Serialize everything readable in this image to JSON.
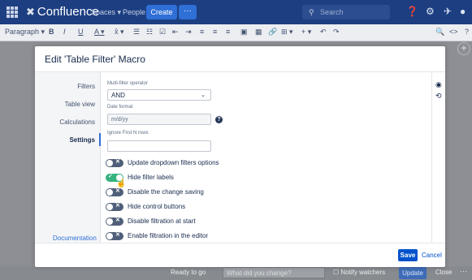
{
  "topnav": {
    "brand": "Confluence",
    "spaces": "Spaces ▾",
    "people": "People",
    "create": "Create",
    "more": "···",
    "search_placeholder": "Search",
    "bg_color": "#1d3f82"
  },
  "toolbar": {
    "paragraph": "Paragraph ▾",
    "bold": "B",
    "italic": "I",
    "underline": "U",
    "text_color": "A ▾",
    "more_format": "x̂ ▾",
    "bullets": "☰",
    "numbered": "☷",
    "task": "☑",
    "outdent": "⇤",
    "indent": "⇥",
    "align_left": "≡",
    "align_center": "≡",
    "align_right": "≡",
    "layout": "▣",
    "image": "▦",
    "link": "🔗",
    "table": "⊞ ▾",
    "insert": "+ ▾",
    "undo": "↶",
    "redo": "↷",
    "find": "🔍",
    "source": "<>",
    "help": "?"
  },
  "dialog": {
    "title": "Edit 'Table Filter' Macro",
    "nav": [
      "Filters",
      "Table view",
      "Calculations",
      "Settings"
    ],
    "active_nav": "Settings",
    "documentation": "Documentation",
    "fields": {
      "multi_filter_label": "Multi-filter operator",
      "multi_filter_value": "AND",
      "date_format_label": "Date format",
      "date_format_value": "m/d/yy",
      "ignore_rows_label": "Ignore First N rows",
      "ignore_rows_value": ""
    },
    "toggles": [
      {
        "label": "Update dropdown filters options",
        "on": false
      },
      {
        "label": "Hide filter labels",
        "on": true
      },
      {
        "label": "Disable the change saving",
        "on": false
      },
      {
        "label": "Hide control buttons",
        "on": false
      },
      {
        "label": "Disable filtration at start",
        "on": false
      },
      {
        "label": "Enable filtration in the editor",
        "on": false
      }
    ],
    "save": "Save",
    "cancel": "Cancel"
  },
  "bottombar": {
    "ready": "Ready to go",
    "change_placeholder": "What did you change?",
    "notify": "Notify watchers",
    "update": "Update",
    "close": "Close",
    "more": "···"
  }
}
